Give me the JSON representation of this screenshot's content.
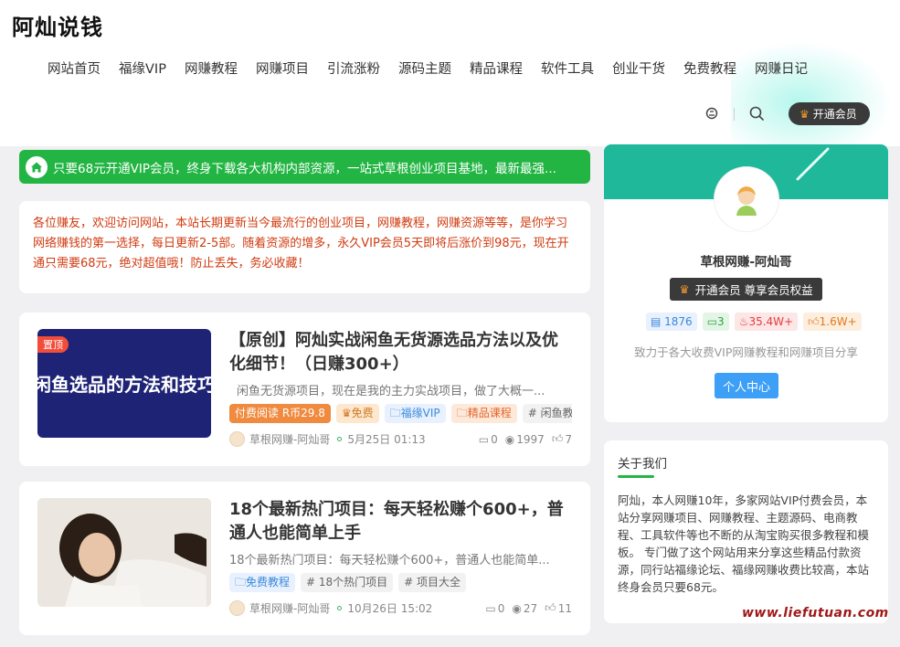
{
  "site": {
    "logo": "阿灿说钱"
  },
  "nav": [
    "网站首页",
    "福缘VIP",
    "网赚教程",
    "网赚项目",
    "引流涨粉",
    "源码主题",
    "精品课程",
    "软件工具",
    "创业干货",
    "免费教程",
    "网赚日记"
  ],
  "header": {
    "vip_button": "开通会员"
  },
  "notice": "只要68元开通VIP会员，终身下载各大机构内部资源，一站式草根创业项目基地，最新最强...",
  "welcome": "各位赚友，欢迎访问网站，本站长期更新当今最流行的创业项目，网赚教程，网赚资源等等，是你学习网络赚钱的第一选择，每日更新2-5部。随着资源的增多，永久VIP会员5天即将后涨价到98元，现在开通只需要68元，绝对超值哦！防止丢失，务必收藏！",
  "posts": [
    {
      "badge": "置顶",
      "thumb_text": "闲鱼选品的方法和技巧",
      "title": "【原创】阿灿实战闲鱼无货源选品方法以及优化细节！（日赚300+）",
      "excerpt": "闲鱼无货源项目，现在是我的主力实战项目，做了大概一...",
      "tags": [
        "付费阅读 R币29.8",
        "免费",
        "福缘VIP",
        "精品课程",
        "# 闲鱼教程"
      ],
      "author": "草根网赚-阿灿哥",
      "date": "5月25日 01:13",
      "comments": "0",
      "views": "1997",
      "likes": "7"
    },
    {
      "title": "18个最新热门项目：每天轻松赚个600+，普通人也能简单上手",
      "excerpt": "18个最新热门项目：每天轻松赚个600+，普通人也能简单...",
      "tags": [
        "免费教程",
        "# 18个热门项目",
        "# 项目大全"
      ],
      "author": "草根网赚-阿灿哥",
      "date": "10月26日 15:02",
      "comments": "0",
      "views": "27",
      "likes": "11"
    }
  ],
  "profile": {
    "name": "草根网赚-阿灿哥",
    "vip_label": "开通会员 尊享会员权益",
    "stats": [
      "1876",
      "3",
      "35.4W+",
      "1.6W+"
    ],
    "desc": "致力于各大收费VIP网赚教程和网赚项目分享",
    "button": "个人中心"
  },
  "about": {
    "heading": "关于我们",
    "text": "阿灿，本人网赚10年，多家网站VIP付费会员，本站分享网赚项目、网赚教程、主题源码、电商教程、工具软件等也不断的从淘宝购买很多教程和模板。 专门做了这个网站用来分享这些精品付款资源，同行站福缘论坛、福缘网赚收费比较高，本站终身会员只要68元。"
  },
  "watermark": "www.liefutuan.com",
  "colors": {
    "accent_green": "#22b543",
    "teal": "#1fb89a",
    "dark": "#3a3a3a",
    "warn_text": "#d03b10"
  }
}
